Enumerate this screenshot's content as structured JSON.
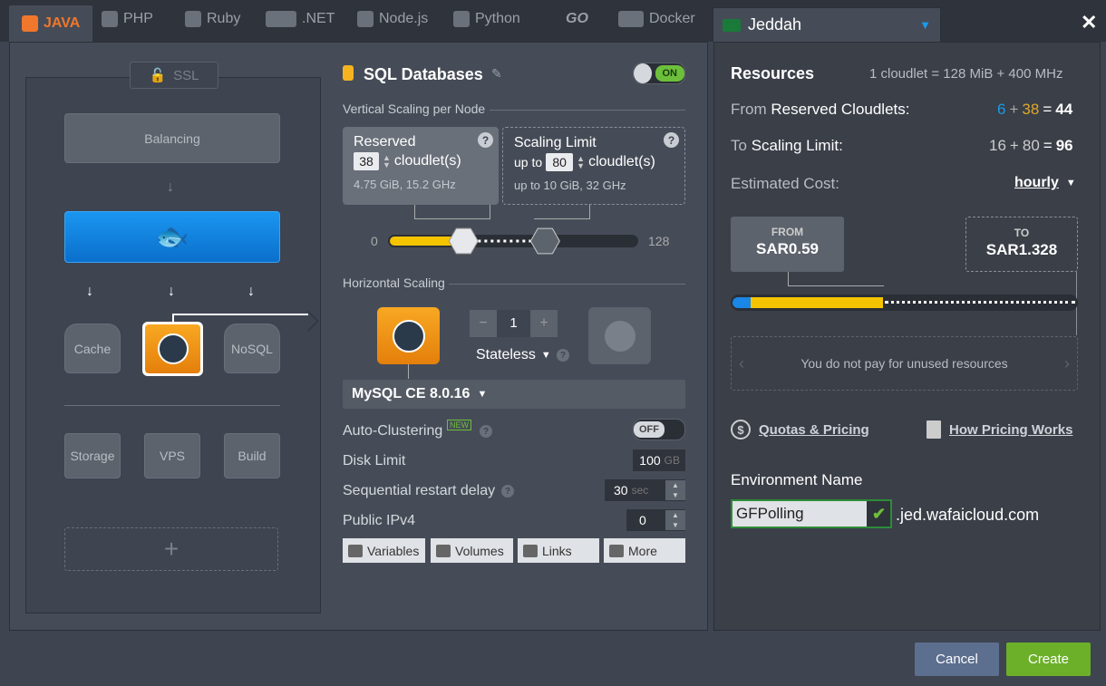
{
  "tabs": [
    {
      "label": "JAVA",
      "icon": "java-icon"
    },
    {
      "label": "PHP",
      "icon": "php-icon"
    },
    {
      "label": "Ruby",
      "icon": "ruby-icon"
    },
    {
      "label": ".NET",
      "icon": "dotnet-icon"
    },
    {
      "label": "Node.js",
      "icon": "nodejs-icon"
    },
    {
      "label": "Python",
      "icon": "python-icon"
    },
    {
      "label": "GO",
      "icon": "go-icon"
    },
    {
      "label": "Docker",
      "icon": "docker-icon"
    }
  ],
  "region": {
    "name": "Jeddah",
    "flag": "saudi-flag-icon"
  },
  "topology": {
    "ssl": "SSL",
    "balancing": "Balancing",
    "cache": "Cache",
    "nosql": "NoSQL",
    "storage": "Storage",
    "vps": "VPS",
    "build": "Build",
    "add": "+"
  },
  "sql": {
    "title": "SQL Databases",
    "toggle": "ON",
    "vertical_title": "Vertical Scaling per Node",
    "reserved": {
      "title": "Reserved",
      "value": "38",
      "unit": "cloudlet(s)",
      "sub": "4.75 GiB, 15.2 GHz"
    },
    "limit": {
      "title": "Scaling Limit",
      "prefix": "up to",
      "value": "80",
      "unit": "cloudlet(s)",
      "sub_prefix": "up to",
      "sub": "10 GiB, 32 GHz"
    },
    "slider": {
      "min": "0",
      "max": "128",
      "reserved": 38,
      "limit": 80,
      "total": 128
    },
    "horizontal_title": "Horizontal Scaling",
    "count": "1",
    "minus": "−",
    "plus": "+",
    "stateless": "Stateless",
    "version": "MySQL CE 8.0.16",
    "auto_clustering": "Auto-Clustering",
    "new_badge": "NEW",
    "auto_toggle": "OFF",
    "disk_limit": "Disk Limit",
    "disk_value": "100",
    "disk_unit": "GB",
    "restart_delay": "Sequential restart delay",
    "restart_value": "30",
    "restart_unit": "sec",
    "ipv4": "Public IPv4",
    "ipv4_value": "0",
    "buttons": [
      "Variables",
      "Volumes",
      "Links",
      "More"
    ]
  },
  "resources": {
    "title": "Resources",
    "cloudlet_info": "1 cloudlet = 128 MiB + 400 MHz",
    "from_label_a": "From",
    "from_label_b": "Reserved Cloudlets:",
    "from_a": "6",
    "plus": "+",
    "from_b": "38",
    "eq": "=",
    "from_total": "44",
    "to_label_a": "To",
    "to_label_b": "Scaling Limit:",
    "to_a": "16",
    "to_b": "80",
    "to_total": "96",
    "cost_label": "Estimated Cost:",
    "period": "hourly",
    "from_caption": "FROM",
    "from_price": "SAR0.59",
    "to_caption": "TO",
    "to_price": "SAR1.328",
    "unused_note": "You do not pay for unused resources",
    "quotas": "Quotas & Pricing",
    "how": "How Pricing Works",
    "env_label": "Environment Name",
    "env_value": "GFPolling",
    "domain": ".jed.wafaicloud.com"
  },
  "footer": {
    "cancel": "Cancel",
    "create": "Create"
  },
  "colors": {
    "accent_orange": "#f0a020",
    "blue": "#1a86e6",
    "green": "#6cbf3a",
    "yellow": "#f5c400"
  }
}
